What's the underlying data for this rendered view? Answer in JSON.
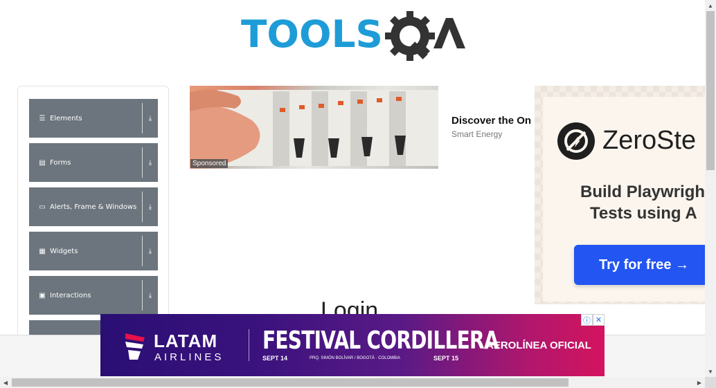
{
  "header": {
    "logo_text": "TOOLSQA"
  },
  "sidebar": {
    "groups": [
      {
        "label": "Elements",
        "icon": "hamburger-icon"
      },
      {
        "label": "Forms",
        "icon": "document-icon"
      },
      {
        "label": "Alerts, Frame & Windows",
        "icon": "window-icon"
      },
      {
        "label": "Widgets",
        "icon": "grid-icon"
      },
      {
        "label": "Interactions",
        "icon": "interaction-icon"
      }
    ],
    "expand_icon": "download-arrow-icon"
  },
  "sponsored_ad": {
    "badge": "Sponsored",
    "title": "Discover the On",
    "brand": "Smart Energy"
  },
  "right_ad": {
    "brand": "ZeroSte",
    "tagline_line1": "Build Playwrigh",
    "tagline_line2": "Tests using A",
    "cta": "Try for free →",
    "brand_color": "#2255f1"
  },
  "main": {
    "title": "Login"
  },
  "bottom_ad": {
    "brand": "LATAM",
    "brand_sub": "AIRLINES",
    "event": "FESTIVAL CORDILLERA",
    "date_start": "SEPT 14",
    "location": "PRQ. SIMÓN BOLÍVAR / BOGOTÁ · COLOMBIA",
    "date_end": "SEPT 15",
    "tag": "AEROLÍNEA OFICIAL",
    "adchoices_icon": "info-icon",
    "close_icon": "close-icon"
  },
  "colors": {
    "logo_blue": "#1e9cd7",
    "logo_dark": "#333333",
    "sidebar_group_bg": "#6c757d"
  }
}
